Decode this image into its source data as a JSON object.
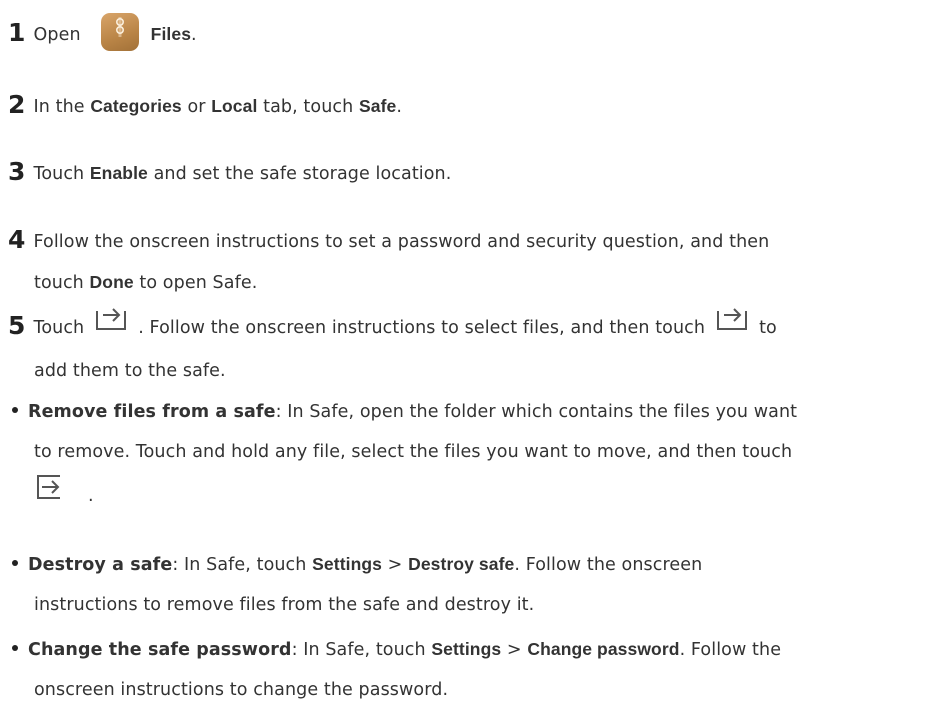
{
  "steps": [
    {
      "num": "1",
      "t1": "Open",
      "b1": "Files",
      "t2": "."
    },
    {
      "num": "2",
      "t1": "In the",
      "b1": "Categories",
      "t2": "or",
      "b2": "Local",
      "t3": "tab, touch",
      "b3": "Safe",
      "t4": "."
    },
    {
      "num": "3",
      "t1": "Touch",
      "b1": "Enable",
      "t2": "and set the safe storage location."
    },
    {
      "num": "4",
      "t1": "Follow the onscreen instructions to set a password and security question, and then",
      "t2": "touch",
      "b1": "Done",
      "t3": "to open Safe."
    },
    {
      "num": "5",
      "t1": "Touch",
      "t2": ". Follow the onscreen instructions to select files, and then touch",
      "t3": "to",
      "t4": "add them to the safe."
    }
  ],
  "bullets": [
    {
      "term": "Remove files from a safe",
      "t1": ": In Safe, open the folder which contains the files you want",
      "t2": "to remove. Touch and hold any file, select the files you want to move, and then touch",
      "t3": "."
    },
    {
      "term": "Destroy a safe",
      "t1": ": In Safe, touch",
      "b1": "Settings",
      "sep": ">",
      "b2": "Destroy safe",
      "t2": ". Follow the onscreen",
      "t3": "instructions to remove files from the safe and destroy it."
    },
    {
      "term": "Change the safe password",
      "t1": ": In Safe, touch",
      "b1": "Settings",
      "sep": ">",
      "b2": "Change password",
      "t2": ". Follow the",
      "t3": "onscreen instructions to change the password."
    }
  ],
  "icons": {
    "app": "files-app-icon",
    "move_in": "move-to-safe-icon",
    "move_out": "move-out-of-safe-icon"
  },
  "colors": {
    "text": "#333333",
    "icon_brown": "#b98446"
  }
}
